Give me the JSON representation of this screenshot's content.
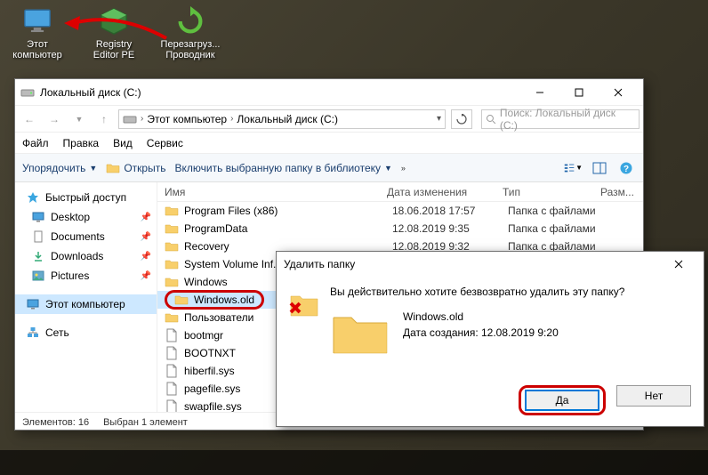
{
  "desktop": {
    "icons": [
      {
        "label": "Этот\nкомпьютер",
        "name": "this-pc"
      },
      {
        "label": "Registry\nEditor PE",
        "name": "registry-editor"
      },
      {
        "label": "Перезагруз...\nПроводник",
        "name": "restart-explorer"
      }
    ]
  },
  "explorer": {
    "title": "Локальный диск (C:)",
    "breadcrumb": [
      "Этот компьютер",
      "Локальный диск (C:)"
    ],
    "search_placeholder": "Поиск: Локальный диск (C:)",
    "menu": {
      "file": "Файл",
      "edit": "Правка",
      "view": "Вид",
      "tools": "Сервис"
    },
    "toolbar": {
      "organize": "Упорядочить",
      "open": "Открыть",
      "include": "Включить выбранную папку в библиотеку"
    },
    "sidebar": {
      "quick_access": "Быстрый доступ",
      "items": [
        {
          "label": "Desktop",
          "icon": "desktop"
        },
        {
          "label": "Documents",
          "icon": "documents"
        },
        {
          "label": "Downloads",
          "icon": "downloads"
        },
        {
          "label": "Pictures",
          "icon": "pictures"
        }
      ],
      "this_pc": "Этот компьютер",
      "network": "Сеть"
    },
    "columns": {
      "name": "Имя",
      "date": "Дата изменения",
      "type": "Тип",
      "size": "Разм..."
    },
    "rows": [
      {
        "name": "Program Files (x86)",
        "date": "18.06.2018 17:57",
        "type": "Папка с файлами",
        "kind": "folder"
      },
      {
        "name": "ProgramData",
        "date": "12.08.2019 9:35",
        "type": "Папка с файлами",
        "kind": "folder"
      },
      {
        "name": "Recovery",
        "date": "12.08.2019 9:32",
        "type": "Папка с файлами",
        "kind": "folder"
      },
      {
        "name": "System Volume Inf...",
        "date": "12.08.2019 9:32",
        "type": "Папка с файлами",
        "kind": "folder"
      },
      {
        "name": "Windows",
        "date": "",
        "type": "",
        "kind": "folder"
      },
      {
        "name": "Windows.old",
        "date": "",
        "type": "",
        "kind": "folder",
        "selected": true,
        "highlight": true
      },
      {
        "name": "Пользователи",
        "date": "",
        "type": "",
        "kind": "folder"
      },
      {
        "name": "bootmgr",
        "date": "",
        "type": "",
        "kind": "file"
      },
      {
        "name": "BOOTNXT",
        "date": "",
        "type": "",
        "kind": "file"
      },
      {
        "name": "hiberfil.sys",
        "date": "",
        "type": "",
        "kind": "file"
      },
      {
        "name": "pagefile.sys",
        "date": "",
        "type": "",
        "kind": "file"
      },
      {
        "name": "swapfile.sys",
        "date": "",
        "type": "",
        "kind": "file"
      }
    ],
    "status": {
      "items": "Элементов: 16",
      "selected": "Выбран 1 элемент"
    }
  },
  "dialog": {
    "title": "Удалить папку",
    "message": "Вы действительно хотите безвозвратно удалить эту папку?",
    "folder_name": "Windows.old",
    "created_label": "Дата создания: 12.08.2019 9:20",
    "yes": "Да",
    "no": "Нет"
  }
}
